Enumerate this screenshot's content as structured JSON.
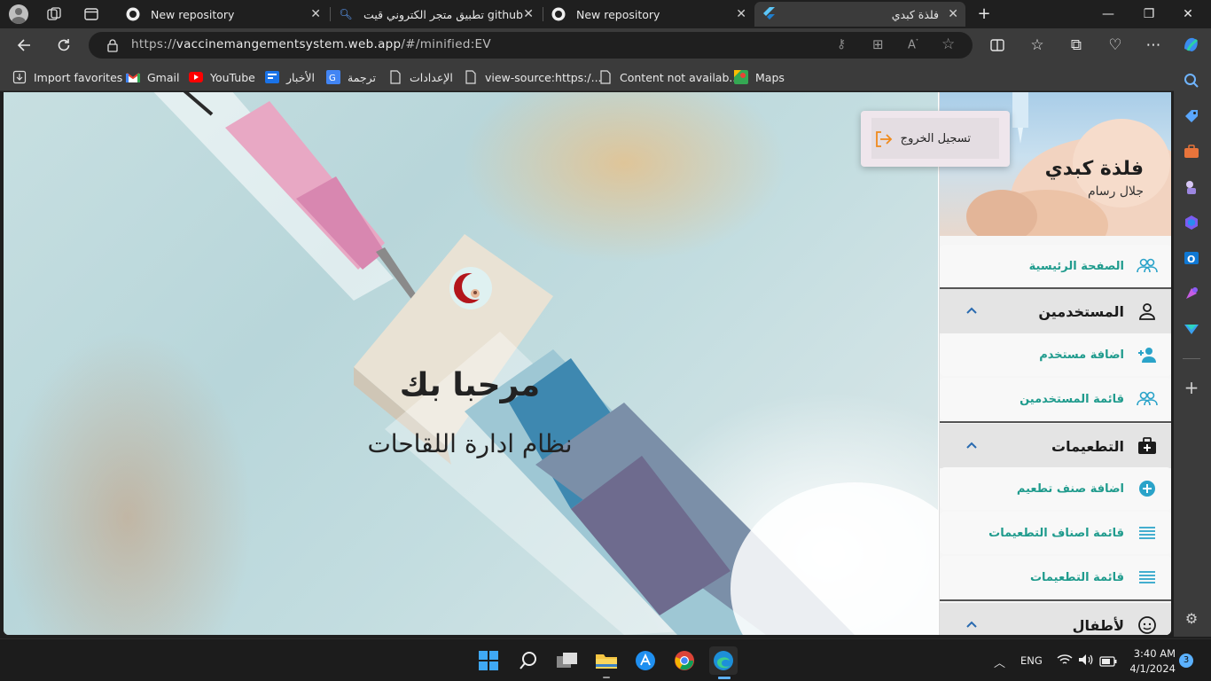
{
  "browser": {
    "tabs": [
      {
        "title": "New repository",
        "active": false
      },
      {
        "title": "github تطبيق متجر الكتروني قيت هب",
        "active": false
      },
      {
        "title": "New repository",
        "active": false
      },
      {
        "title": "فلذة كبدي",
        "active": true
      }
    ],
    "url_prefix": "https://",
    "url_host": "vaccinemangementsystem.web.app",
    "url_path": "/#/minified:EV",
    "favorites": [
      {
        "label": "Import favorites",
        "icon": "import-icon"
      },
      {
        "label": "Gmail",
        "icon": "gmail-icon"
      },
      {
        "label": "YouTube",
        "icon": "youtube-icon"
      },
      {
        "label": "الأخبار",
        "icon": "news-icon"
      },
      {
        "label": "ترجمة",
        "icon": "translate-icon"
      },
      {
        "label": "الإعدادات",
        "icon": "page-icon"
      },
      {
        "label": "view-source:https:/...",
        "icon": "page-icon"
      },
      {
        "label": "Content not availab...",
        "icon": "page-icon"
      },
      {
        "label": "Maps",
        "icon": "maps-icon"
      }
    ]
  },
  "hero": {
    "welcome": "مرحبا بك",
    "subtitle": "نظام ادارة اللقاحات"
  },
  "drawer": {
    "user_name": "فلذة كبدي",
    "user_sub": "جلال رسام",
    "home": "الصفحة الرئيسية",
    "users_section": "المستخدمين",
    "add_user": "اضافة مستخدم",
    "users_list": "قائمة المستخدمين",
    "vaccines_section": "التطعيمات",
    "add_vaccine_type": "اضافة صنف تطعيم",
    "vaccine_types_list": "قائمة اصناف التطعيمات",
    "vaccines_list": "قائمة التطعيمات",
    "children_section": "لأطفال",
    "accent": "#1f9b8d"
  },
  "logout": {
    "label": "تسجيل الخروج",
    "icon_color": "#f08a1c"
  },
  "taskbar": {
    "lang": "ENG",
    "time": "3:40 AM",
    "date": "4/1/2024",
    "notifications": "3"
  }
}
